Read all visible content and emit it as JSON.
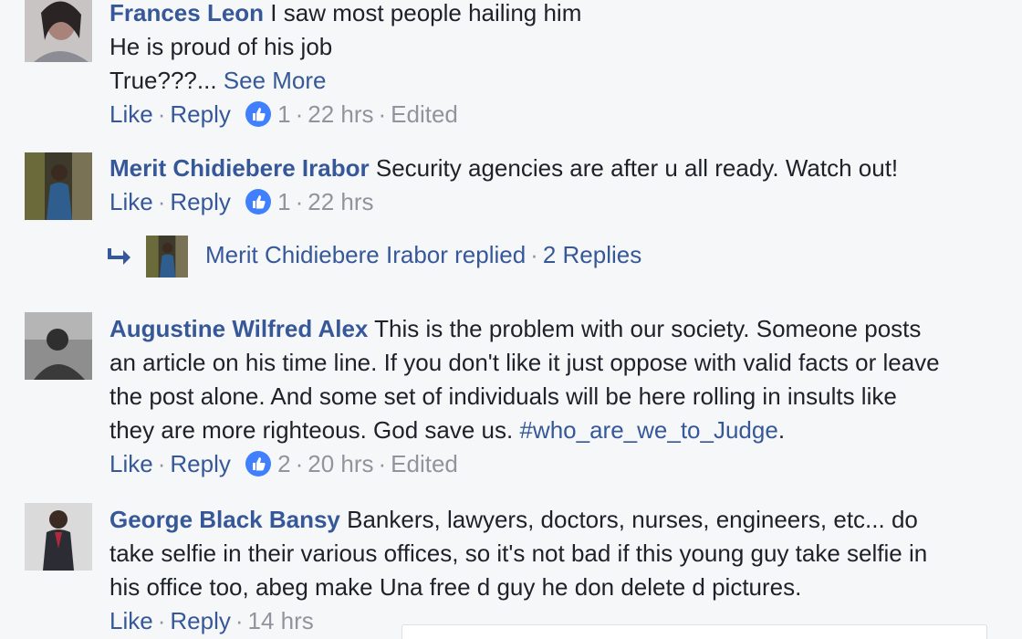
{
  "comments": [
    {
      "author": "Frances Leon",
      "lines": [
        "I saw most people hailing him",
        "He is proud of his job",
        "True???..."
      ],
      "see_more": "See More",
      "actions": {
        "like": "Like",
        "reply": "Reply",
        "likes": "1",
        "time": "22 hrs",
        "edited": "Edited"
      }
    },
    {
      "author": "Merit Chidiebere Irabor",
      "lines": [
        "Security agencies are after u all ready. Watch out!"
      ],
      "actions": {
        "like": "Like",
        "reply": "Reply",
        "likes": "1",
        "time": "22 hrs"
      },
      "replies": {
        "text": "Merit Chidiebere Irabor replied",
        "count": "2 Replies"
      }
    },
    {
      "author": "Augustine Wilfred Alex",
      "lines": [
        "This is the problem with our society. Someone posts",
        "an article on his time line. If you don't like it just oppose with valid facts or leave",
        "the post alone. And some set of individuals will be here rolling in insults like",
        "they are more righteous. God save us."
      ],
      "hashtag": "#who_are_we_to_Judge",
      "after_hashtag": ".",
      "actions": {
        "like": "Like",
        "reply": "Reply",
        "likes": "2",
        "time": "20 hrs",
        "edited": "Edited"
      }
    },
    {
      "author": "George Black Bansy",
      "lines": [
        "Bankers, lawyers, doctors, nurses, engineers, etc... do",
        "take selfie in their various offices, so it's not bad if this young guy take selfie in",
        "his office too, abeg make Una free d guy he don delete d pictures."
      ],
      "actions": {
        "like": "Like",
        "reply": "Reply",
        "time": "14 hrs"
      }
    }
  ],
  "icons": {
    "like_badge": "thumbs-up-icon",
    "reply_arrow": "reply-arrow-icon"
  },
  "colors": {
    "link": "#365899",
    "meta": "#90949c",
    "background": "#f6f7f9",
    "like_blue": "#4080ff"
  }
}
